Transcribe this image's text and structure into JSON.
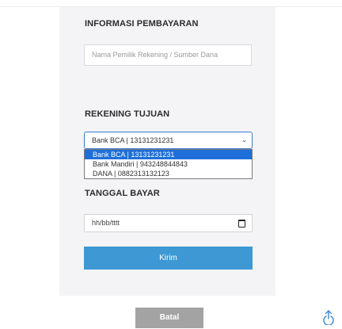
{
  "payment_info": {
    "title": "INFORMASI PEMBAYARAN",
    "account_owner_placeholder": "Nama Pemilik Rekening / Sumber Dana"
  },
  "destination": {
    "title": "REKENING TUJUAN",
    "selected": "Bank BCA | 13131231231",
    "options": [
      "Bank BCA | 13131231231",
      "Bank Mandiri | 943248844843",
      "DANA | 0882313132123"
    ]
  },
  "payment_date": {
    "title": "TANGGAL BAYAR",
    "placeholder": "hh/bb/tttt"
  },
  "actions": {
    "submit_label": "Kirim",
    "cancel_label": "Batal"
  },
  "colors": {
    "submit_bg": "#3d98d4",
    "cancel_bg": "#a3a3a3",
    "selected_option_bg": "#1e6fd9",
    "panel_bg": "#f4f4f6"
  },
  "icons": {
    "select_chevron": "chevron-down-icon",
    "date_picker": "calendar-icon",
    "share": "share-icon"
  }
}
